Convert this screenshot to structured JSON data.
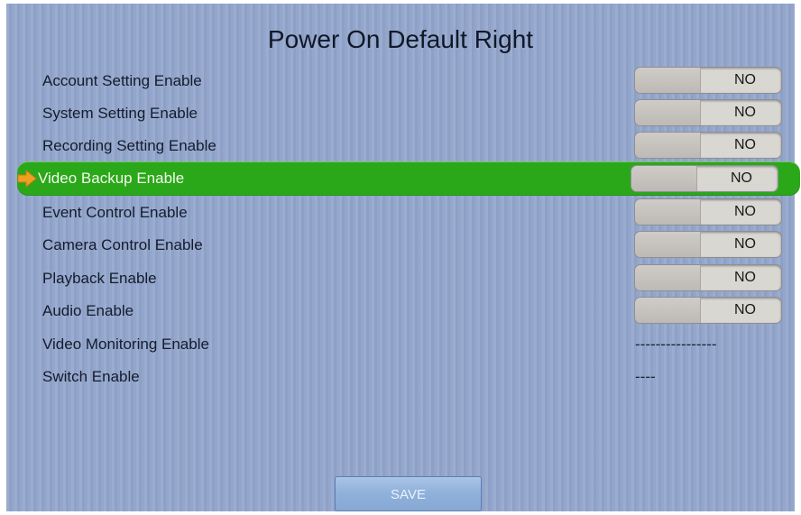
{
  "page": {
    "title": "Power On Default Right",
    "save_label": "SAVE"
  },
  "rows": [
    {
      "label": "Account Setting Enable",
      "value": "NO"
    },
    {
      "label": "System Setting Enable",
      "value": "NO"
    },
    {
      "label": "Recording Setting Enable",
      "value": "NO"
    },
    {
      "label": "Video Backup Enable",
      "value": "NO"
    },
    {
      "label": "Event Control Enable",
      "value": "NO"
    },
    {
      "label": "Camera Control Enable",
      "value": "NO"
    },
    {
      "label": "Playback Enable",
      "value": "NO"
    },
    {
      "label": "Audio Enable",
      "value": "NO"
    },
    {
      "label": "Video Monitoring Enable",
      "value": "----------------"
    },
    {
      "label": "Switch Enable",
      "value": "----"
    }
  ],
  "colors": {
    "background": "#93a6cc",
    "selected_row": "#2aa81a",
    "selection_arrow": "#f0a020"
  }
}
